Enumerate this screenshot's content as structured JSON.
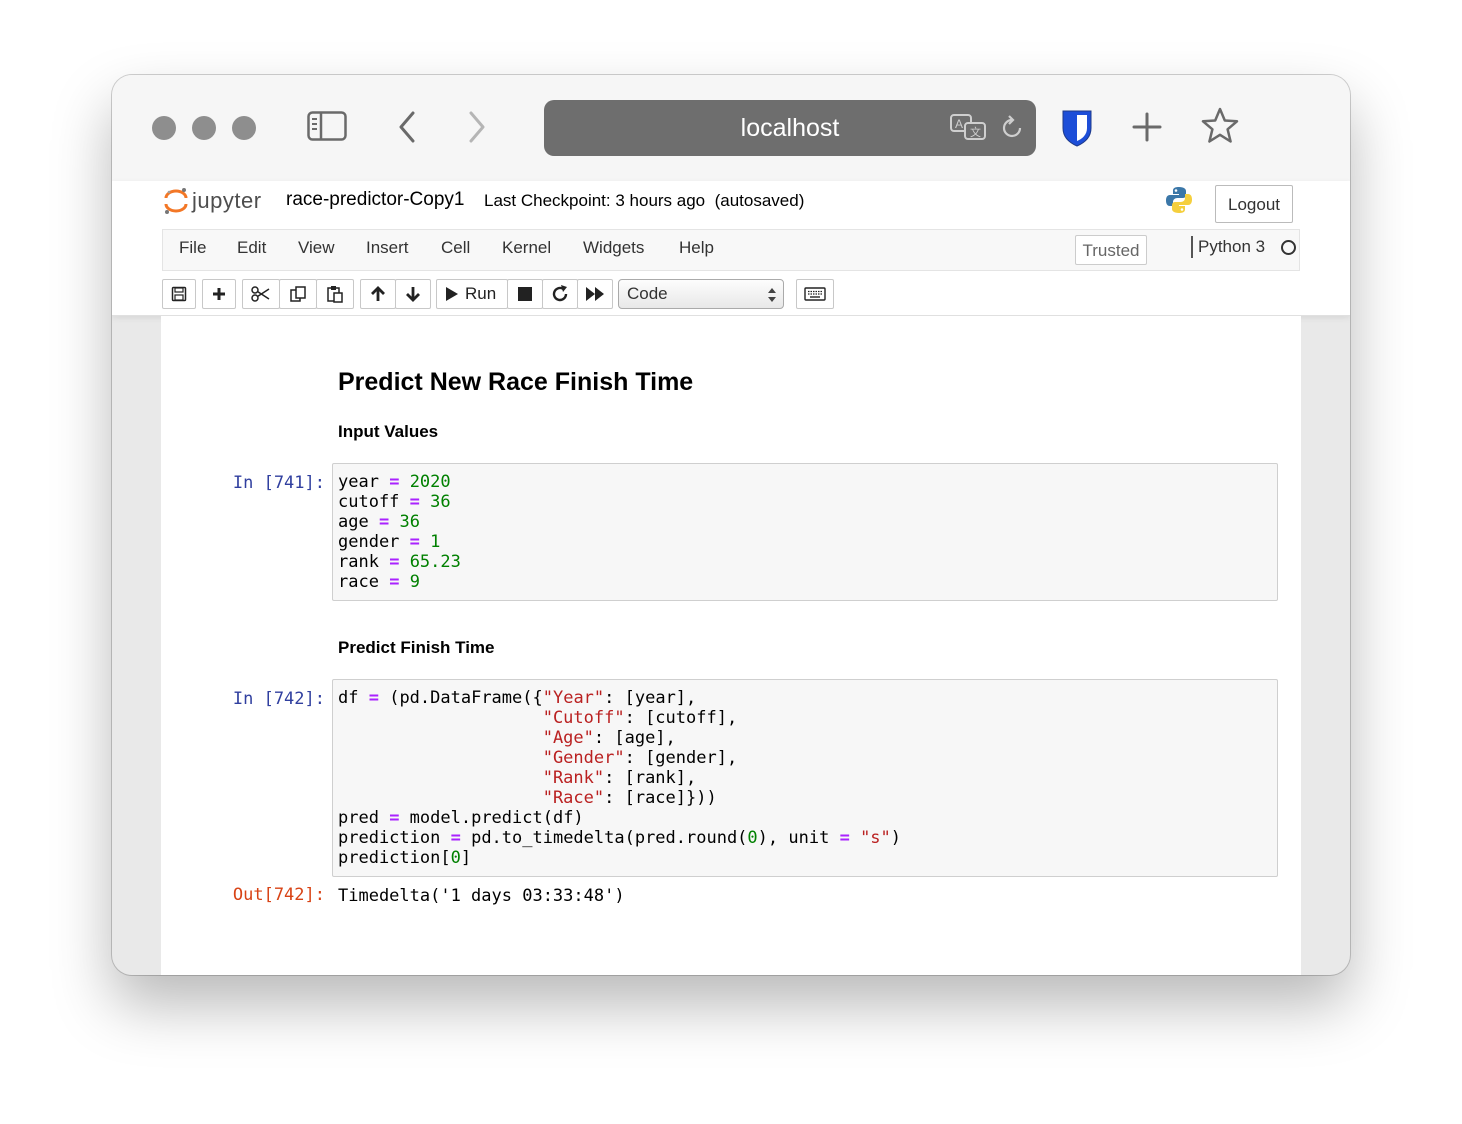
{
  "browser": {
    "url": "localhost",
    "icons": [
      "sidebar-icon",
      "back-icon",
      "forward-icon",
      "translate-icon",
      "reload-icon",
      "bitwarden-shield-icon",
      "new-tab-icon",
      "bookmark-star-icon"
    ]
  },
  "header": {
    "logo_text": "jupyter",
    "notebook_name": "race-predictor-Copy1",
    "checkpoint": "Last Checkpoint: 3 hours ago",
    "autosaved": "(autosaved)",
    "logout_label": "Logout"
  },
  "menu": {
    "items": [
      "File",
      "Edit",
      "View",
      "Insert",
      "Cell",
      "Kernel",
      "Widgets",
      "Help"
    ],
    "trusted": "Trusted",
    "kernel": "Python 3"
  },
  "toolbar": {
    "run_label": "Run",
    "cell_type": "Code"
  },
  "notebook": {
    "heading": "Predict New Race Finish Time",
    "subheading1": "Input Values",
    "subheading2": "Predict Finish Time",
    "cell1_prompt": "In [741]:",
    "cell2_prompt": "In [742]:",
    "out_prompt": "Out[742]:",
    "cell1_lines": [
      [
        [
          "year ",
          ""
        ],
        [
          "=",
          "op"
        ],
        [
          " ",
          ""
        ],
        [
          "2020",
          "num"
        ]
      ],
      [
        [
          "cutoff ",
          ""
        ],
        [
          "=",
          "op"
        ],
        [
          " ",
          ""
        ],
        [
          "36",
          "num"
        ]
      ],
      [
        [
          "age ",
          ""
        ],
        [
          "=",
          "op"
        ],
        [
          " ",
          ""
        ],
        [
          "36",
          "num"
        ]
      ],
      [
        [
          "gender ",
          ""
        ],
        [
          "=",
          "op"
        ],
        [
          " ",
          ""
        ],
        [
          "1",
          "num"
        ]
      ],
      [
        [
          "rank ",
          ""
        ],
        [
          "=",
          "op"
        ],
        [
          " ",
          ""
        ],
        [
          "65.23",
          "num"
        ]
      ],
      [
        [
          "race ",
          ""
        ],
        [
          "=",
          "op"
        ],
        [
          " ",
          ""
        ],
        [
          "9",
          "num"
        ]
      ]
    ],
    "cell2_lines": [
      [
        [
          "df ",
          ""
        ],
        [
          "=",
          "op"
        ],
        [
          " (pd.DataFrame({",
          ""
        ],
        [
          "\"Year\"",
          "str"
        ],
        [
          ": [year],",
          ""
        ]
      ],
      [
        [
          "                    ",
          ""
        ],
        [
          "\"Cutoff\"",
          "str"
        ],
        [
          ": [cutoff],",
          ""
        ]
      ],
      [
        [
          "                    ",
          ""
        ],
        [
          "\"Age\"",
          "str"
        ],
        [
          ": [age],",
          ""
        ]
      ],
      [
        [
          "                    ",
          ""
        ],
        [
          "\"Gender\"",
          "str"
        ],
        [
          ": [gender],",
          ""
        ]
      ],
      [
        [
          "                    ",
          ""
        ],
        [
          "\"Rank\"",
          "str"
        ],
        [
          ": [rank],",
          ""
        ]
      ],
      [
        [
          "                    ",
          ""
        ],
        [
          "\"Race\"",
          "str"
        ],
        [
          ": [race]}))",
          ""
        ]
      ],
      [
        [
          "pred ",
          ""
        ],
        [
          "=",
          "op"
        ],
        [
          " model.predict(df)",
          ""
        ]
      ],
      [
        [
          "prediction ",
          ""
        ],
        [
          "=",
          "op"
        ],
        [
          " pd.to_timedelta(pred.round(",
          ""
        ],
        [
          "0",
          "num"
        ],
        [
          "), unit ",
          ""
        ],
        [
          "=",
          "op"
        ],
        [
          " ",
          ""
        ],
        [
          "\"s\"",
          "str"
        ],
        [
          ")",
          ""
        ]
      ],
      [
        [
          "prediction[",
          ""
        ],
        [
          "0",
          "num"
        ],
        [
          "]",
          ""
        ]
      ]
    ],
    "output": "Timedelta('1 days 03:33:48')"
  }
}
